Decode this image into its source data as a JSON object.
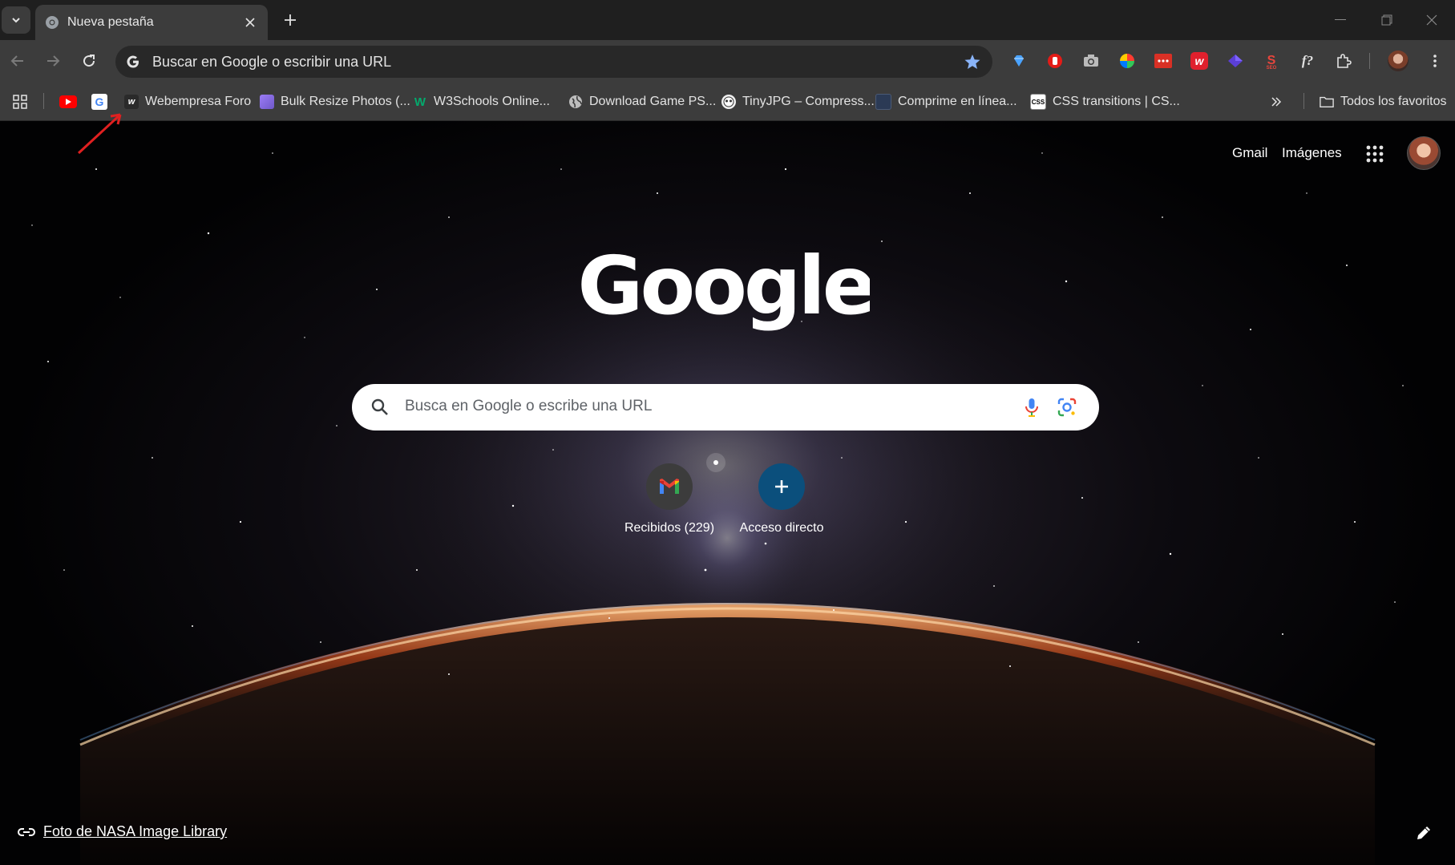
{
  "tabstrip": {
    "tab_title": "Nueva pestaña"
  },
  "toolbar": {
    "omnibox_text": "Buscar en Google o escribir una URL"
  },
  "bookmarks": {
    "items": [
      {
        "label": "",
        "icon": "youtube-icon"
      },
      {
        "label": "",
        "icon": "google-icon"
      },
      {
        "label": "Webempresa Foro",
        "icon": "webempresa-icon"
      },
      {
        "label": "Bulk Resize Photos (...",
        "icon": "bulk-resize-icon"
      },
      {
        "label": "W3Schools Online...",
        "icon": "w3schools-icon"
      },
      {
        "label": "Download Game PS...",
        "icon": "globe-icon"
      },
      {
        "label": "TinyJPG – Compress...",
        "icon": "tinyjpg-icon"
      },
      {
        "label": "Comprime en línea...",
        "icon": "compress-icon"
      },
      {
        "label": "CSS transitions | CS...",
        "icon": "css3-icon"
      }
    ],
    "all_bookmarks": "Todos los favoritos"
  },
  "ntp": {
    "gmail": "Gmail",
    "images": "Imágenes",
    "search_placeholder": "Busca en Google o escribe una URL",
    "shortcuts": [
      {
        "label": "Recibidos (229)",
        "icon": "gmail-icon"
      },
      {
        "label": "Acceso directo",
        "icon": "plus-icon"
      }
    ],
    "photo_credit": "Foto de NASA Image Library"
  },
  "colors": {
    "accent_blue": "#0b57d0",
    "shortcut_add_bg": "#0b4f7c",
    "tab_bg": "#3c3c3c",
    "tabstrip_bg": "#1f1f1f"
  }
}
